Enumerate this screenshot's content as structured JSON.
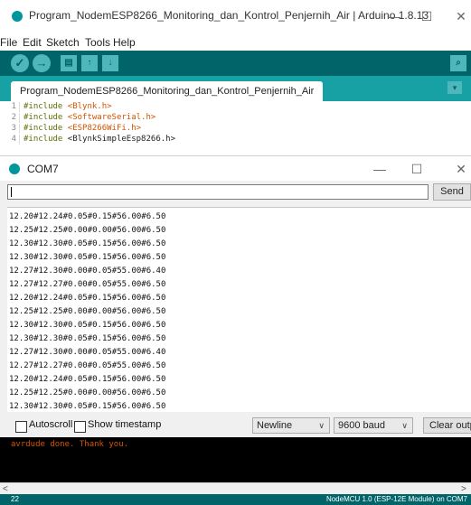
{
  "ide": {
    "title": "Program_NodemESP8266_Monitoring_dan_Kontrol_Penjernih_Air | Arduino 1.8.13",
    "window_controls": {
      "minimize": "—",
      "maximize": "☐",
      "close": "✕"
    },
    "menu": [
      "File",
      "Edit",
      "Sketch",
      "Tools",
      "Help"
    ],
    "toolbar": {
      "verify": "✓",
      "upload": "→",
      "new": "▤",
      "open": "↑",
      "save": "↓",
      "serial_monitor": "⌕"
    },
    "tab": {
      "label": "Program_NodemESP8266_Monitoring_dan_Kontrol_Penjernih_Air",
      "menu": "▾"
    },
    "code": [
      {
        "num": "1",
        "directive": "#include ",
        "header": "<Blynk.h>"
      },
      {
        "num": "2",
        "directive": "#include ",
        "header": "<SoftwareSerial.h>"
      },
      {
        "num": "3",
        "directive": "#include ",
        "header": "<ESP8266WiFi.h>"
      },
      {
        "num": "4",
        "directive": "#include ",
        "header": "<BlynkSimpleEsp8266.h>"
      }
    ]
  },
  "serial": {
    "title": "COM7",
    "window_controls": {
      "minimize": "—",
      "maximize": "☐",
      "close": "✕"
    },
    "input_value": "",
    "send_label": "Send",
    "output": [
      "12.20#12.24#0.05#0.15#56.00#6.50",
      "12.25#12.25#0.00#0.00#56.00#6.50",
      "12.30#12.30#0.05#0.15#56.00#6.50",
      "12.30#12.30#0.05#0.15#56.00#6.50",
      "12.27#12.30#0.00#0.05#55.00#6.40",
      "12.27#12.27#0.00#0.05#55.00#6.50",
      "12.20#12.24#0.05#0.15#56.00#6.50",
      "12.25#12.25#0.00#0.00#56.00#6.50",
      "12.30#12.30#0.05#0.15#56.00#6.50",
      "12.30#12.30#0.05#0.15#56.00#6.50",
      "12.27#12.30#0.00#0.05#55.00#6.40",
      "12.27#12.27#0.00#0.05#55.00#6.50",
      "12.20#12.24#0.05#0.15#56.00#6.50",
      "12.25#12.25#0.00#0.00#56.00#6.50",
      "12.30#12.30#0.05#0.15#56.00#6.50"
    ],
    "autoscroll_label": "Autoscroll",
    "autoscroll_checked": false,
    "timestamp_label": "Show timestamp",
    "timestamp_checked": false,
    "line_ending": "Newline",
    "baud": "9600 baud",
    "clear_label": "Clear output",
    "arrow": "∨"
  },
  "console": {
    "text": "avrdude done.  Thank you."
  },
  "scroll": {
    "left": "<",
    "right": ">"
  },
  "status": {
    "line": "22",
    "board": "NodeMCU 1.0 (ESP-12E Module) on COM7"
  },
  "colors": {
    "teal_dark": "#006468",
    "teal": "#17a1a5",
    "console_text": "#d35400"
  }
}
